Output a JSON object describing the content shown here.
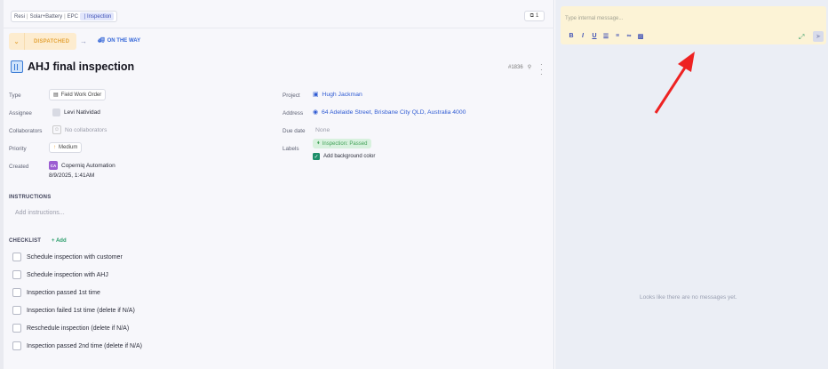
{
  "breadcrumb": [
    "Resi",
    "Solar+Battery",
    "EPC",
    "Inspection"
  ],
  "copy_count": "1",
  "status": {
    "current": "DISPATCHED",
    "next": "ON THE WAY"
  },
  "title": "AHJ final inspection",
  "ticket_id": "#1836",
  "fields_left": {
    "type_label": "Type",
    "type_value": "Field Work Order",
    "assignee_label": "Assignee",
    "assignee_value": "Levi Natividad",
    "collab_label": "Collaborators",
    "collab_value": "No collaborators",
    "priority_label": "Priority",
    "priority_value": "Medium",
    "created_label": "Created",
    "created_by": "Coperniq Automation",
    "created_avatar": "CA",
    "created_at": "8/9/2025, 1:41AM"
  },
  "fields_right": {
    "project_label": "Project",
    "project_value": "Hugh Jackman",
    "address_label": "Address",
    "address_value": "64 Adelaide Street, Brisbane City QLD, Australia 4000",
    "due_label": "Due date",
    "due_value": "None",
    "labels_label": "Labels",
    "label_badge": "Inspection: Passed",
    "bg_color_label": "Add background color"
  },
  "instructions": {
    "title": "INSTRUCTIONS",
    "placeholder": "Add instructions..."
  },
  "checklist": {
    "title": "CHECKLIST",
    "add_label": "+ Add",
    "items": [
      "Schedule inspection with customer",
      "Schedule inspection with AHJ",
      "Inspection passed 1st time",
      "Inspection failed 1st time (delete if N/A)",
      "Reschedule inspection (delete if N/A)",
      "Inspection passed 2nd time (delete if N/A)"
    ]
  },
  "composer": {
    "placeholder": "Type internal message..."
  },
  "messages": {
    "empty": "Looks like there are no messages yet."
  },
  "colors": {
    "accent": "#3d4fb5",
    "status_bg": "#fdeccf",
    "annotation_arrow": "#ee2222"
  },
  "icons": [
    "copy-icon",
    "chevron-down-icon",
    "truck-icon",
    "building-icon",
    "pin-icon",
    "more-icon",
    "bold-icon",
    "italic-icon",
    "underline-icon",
    "ordered-list-icon",
    "bullet-list-icon",
    "link-icon",
    "image-icon",
    "expand-icon",
    "send-icon",
    "tag-icon",
    "location-icon",
    "briefcase-icon"
  ]
}
